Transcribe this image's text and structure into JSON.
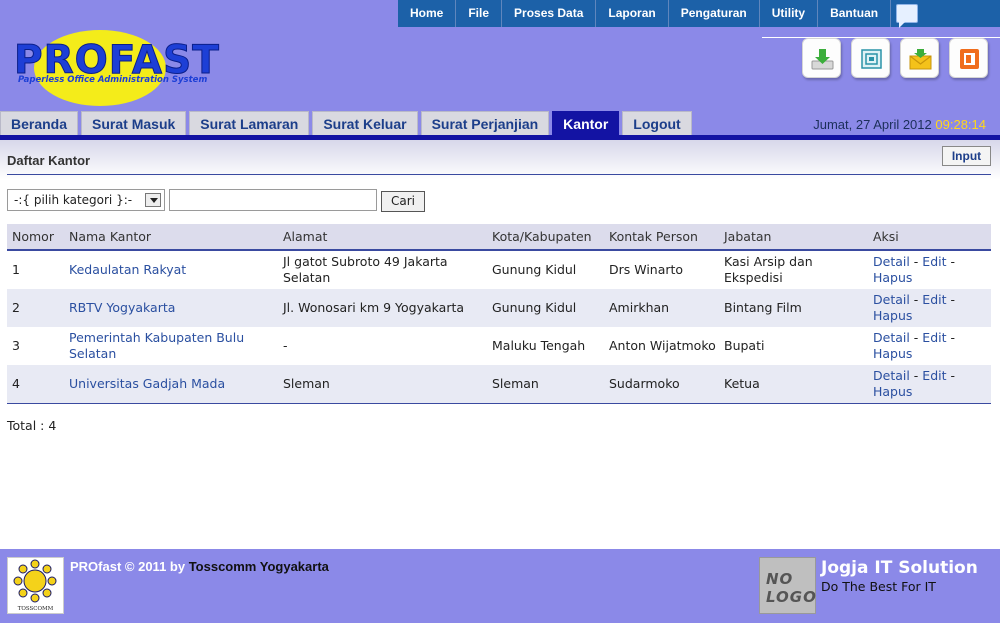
{
  "top_menu": [
    "Home",
    "File",
    "Proses Data",
    "Laporan",
    "Pengaturan",
    "Utility",
    "Bantuan"
  ],
  "logo": {
    "name": "PROFAST",
    "tagline": "Paperless Office Administration System"
  },
  "toolbar_icons": [
    "download-icon",
    "archive-icon",
    "mail-icon",
    "powerpoint-icon"
  ],
  "tabs": [
    {
      "label": "Beranda",
      "active": false
    },
    {
      "label": "Surat Masuk",
      "active": false
    },
    {
      "label": "Surat Lamaran",
      "active": false
    },
    {
      "label": "Surat Keluar",
      "active": false
    },
    {
      "label": "Surat Perjanjian",
      "active": false
    },
    {
      "label": "Kantor",
      "active": true
    },
    {
      "label": "Logout",
      "active": false
    }
  ],
  "datetime": {
    "date": "Jumat, 27 April 2012",
    "time": "09:28:14"
  },
  "page": {
    "title": "Daftar Kantor",
    "input_button": "Input"
  },
  "filter": {
    "category_selected": "-:{ pilih kategori }:-",
    "search_value": "",
    "search_button": "Cari"
  },
  "table": {
    "headers": [
      "Nomor",
      "Nama Kantor",
      "Alamat",
      "Kota/Kabupaten",
      "Kontak Person",
      "Jabatan",
      "Aksi"
    ],
    "rows": [
      {
        "no": "1",
        "name": "Kedaulatan Rakyat",
        "address": "Jl gatot Subroto 49 Jakarta Selatan",
        "city": "Gunung Kidul",
        "contact": "Drs Winarto",
        "position": "Kasi Arsip dan Ekspedisi"
      },
      {
        "no": "2",
        "name": "RBTV Yogyakarta",
        "address": "Jl. Wonosari km 9 Yogyakarta",
        "city": "Gunung Kidul",
        "contact": "Amirkhan",
        "position": "Bintang Film"
      },
      {
        "no": "3",
        "name": "Pemerintah Kabupaten Bulu Selatan",
        "address": "-",
        "city": "Maluku Tengah",
        "contact": "Anton Wijatmoko",
        "position": "Bupati"
      },
      {
        "no": "4",
        "name": "Universitas Gadjah Mada",
        "address": "Sleman",
        "city": "Sleman",
        "contact": "Sudarmoko",
        "position": "Ketua"
      }
    ],
    "actions": {
      "detail": "Detail",
      "edit": "Edit",
      "hapus": "Hapus",
      "sep": " - "
    }
  },
  "total": "Total : 4",
  "footer": {
    "copyright": "PROfast © 2011 by",
    "company": "Tosscomm Yogyakarta",
    "logo_caption": "TOSSCOMM",
    "nologo_top": "NO",
    "nologo_bottom": "LOGO",
    "partner_title": "Jogja IT Solution",
    "partner_tagline": "Do The Best For IT"
  },
  "colors": {
    "header_bg": "#8b89e8",
    "menu_bg": "#1c61a8",
    "active_tab": "#1313a3",
    "link": "#2a4fa0",
    "time": "#ffd71a"
  }
}
